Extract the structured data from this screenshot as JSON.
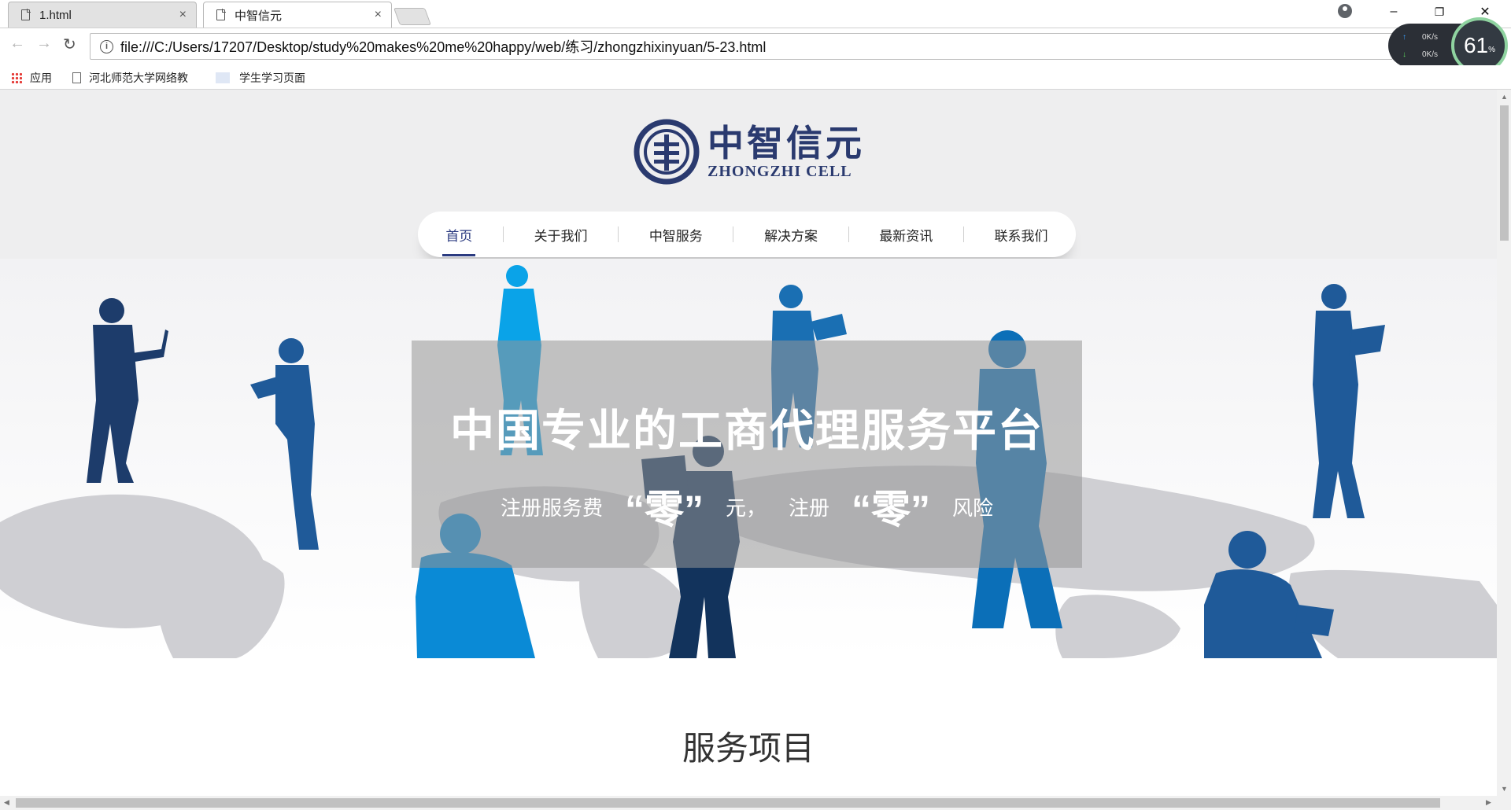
{
  "browser": {
    "tabs": [
      {
        "title": "1.html",
        "close": "×"
      },
      {
        "title": "中智信元",
        "close": "×"
      }
    ],
    "window_controls": {
      "minimize": "–",
      "restore": "❐",
      "close": "✕"
    },
    "address": "file:///C:/Users/17207/Desktop/study%20makes%20me%20happy/web/练习/zhongzhixinyuan/5-23.html",
    "bookmarks": [
      {
        "label": "应用"
      },
      {
        "label": "河北师范大学网络教"
      },
      {
        "label": "学生学习页面"
      }
    ],
    "speed_widget": {
      "up": "0K/s",
      "down": "0K/s",
      "percent": "61",
      "unit": "%"
    }
  },
  "page": {
    "logo": {
      "cn": "中智信元",
      "en": "ZHONGZHI CELL",
      "brand_color": "#2a3a6f"
    },
    "nav": [
      {
        "label": "首页",
        "active": true
      },
      {
        "label": "关于我们"
      },
      {
        "label": "中智服务"
      },
      {
        "label": "解决方案"
      },
      {
        "label": "最新资讯"
      },
      {
        "label": "联系我们"
      }
    ],
    "banner": {
      "headline": "中国专业的工商代理服务平台",
      "sub1": "注册服务费",
      "quote1": "“零”",
      "sub2": "元，",
      "sub3": "注册",
      "quote2": "“零”",
      "sub4": "风险"
    },
    "section_title": "服务项目"
  }
}
